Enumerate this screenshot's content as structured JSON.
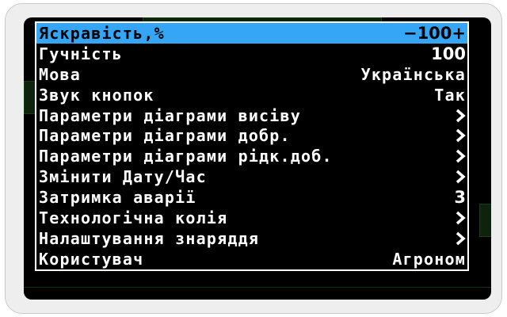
{
  "settings_menu": {
    "items": [
      {
        "label": "Яскравість,%",
        "value": "−100+",
        "selected": true,
        "type": "number"
      },
      {
        "label": "Гучність",
        "value": "100",
        "type": "number"
      },
      {
        "label": "Мова",
        "value": "Українська",
        "type": "text"
      },
      {
        "label": "Звук кнопок",
        "value": "Так",
        "type": "text"
      },
      {
        "label": "Параметри діаграми висіву",
        "value": "",
        "type": "submenu",
        "icon": "chevron-right-icon"
      },
      {
        "label": "Параметри діаграми добр.",
        "value": "",
        "type": "submenu",
        "icon": "chevron-right-icon"
      },
      {
        "label": "Параметри діаграми рідк.доб.",
        "value": "",
        "type": "submenu",
        "icon": "chevron-right-icon"
      },
      {
        "label": "Змінити Дату/Час",
        "value": "",
        "type": "submenu",
        "icon": "chevron-right-icon"
      },
      {
        "label": "Затримка аварії",
        "value": "3",
        "type": "number"
      },
      {
        "label": "Технологічна колія",
        "value": "",
        "type": "submenu",
        "icon": "chevron-right-icon"
      },
      {
        "label": "Налаштування знаряддя",
        "value": "",
        "type": "submenu",
        "icon": "chevron-right-icon"
      },
      {
        "label": "Користувач",
        "value": "Агроном",
        "type": "text"
      }
    ]
  },
  "colors": {
    "selection": "#35a6f5",
    "screen_background": "#000000",
    "menu_text": "#ffffff"
  }
}
